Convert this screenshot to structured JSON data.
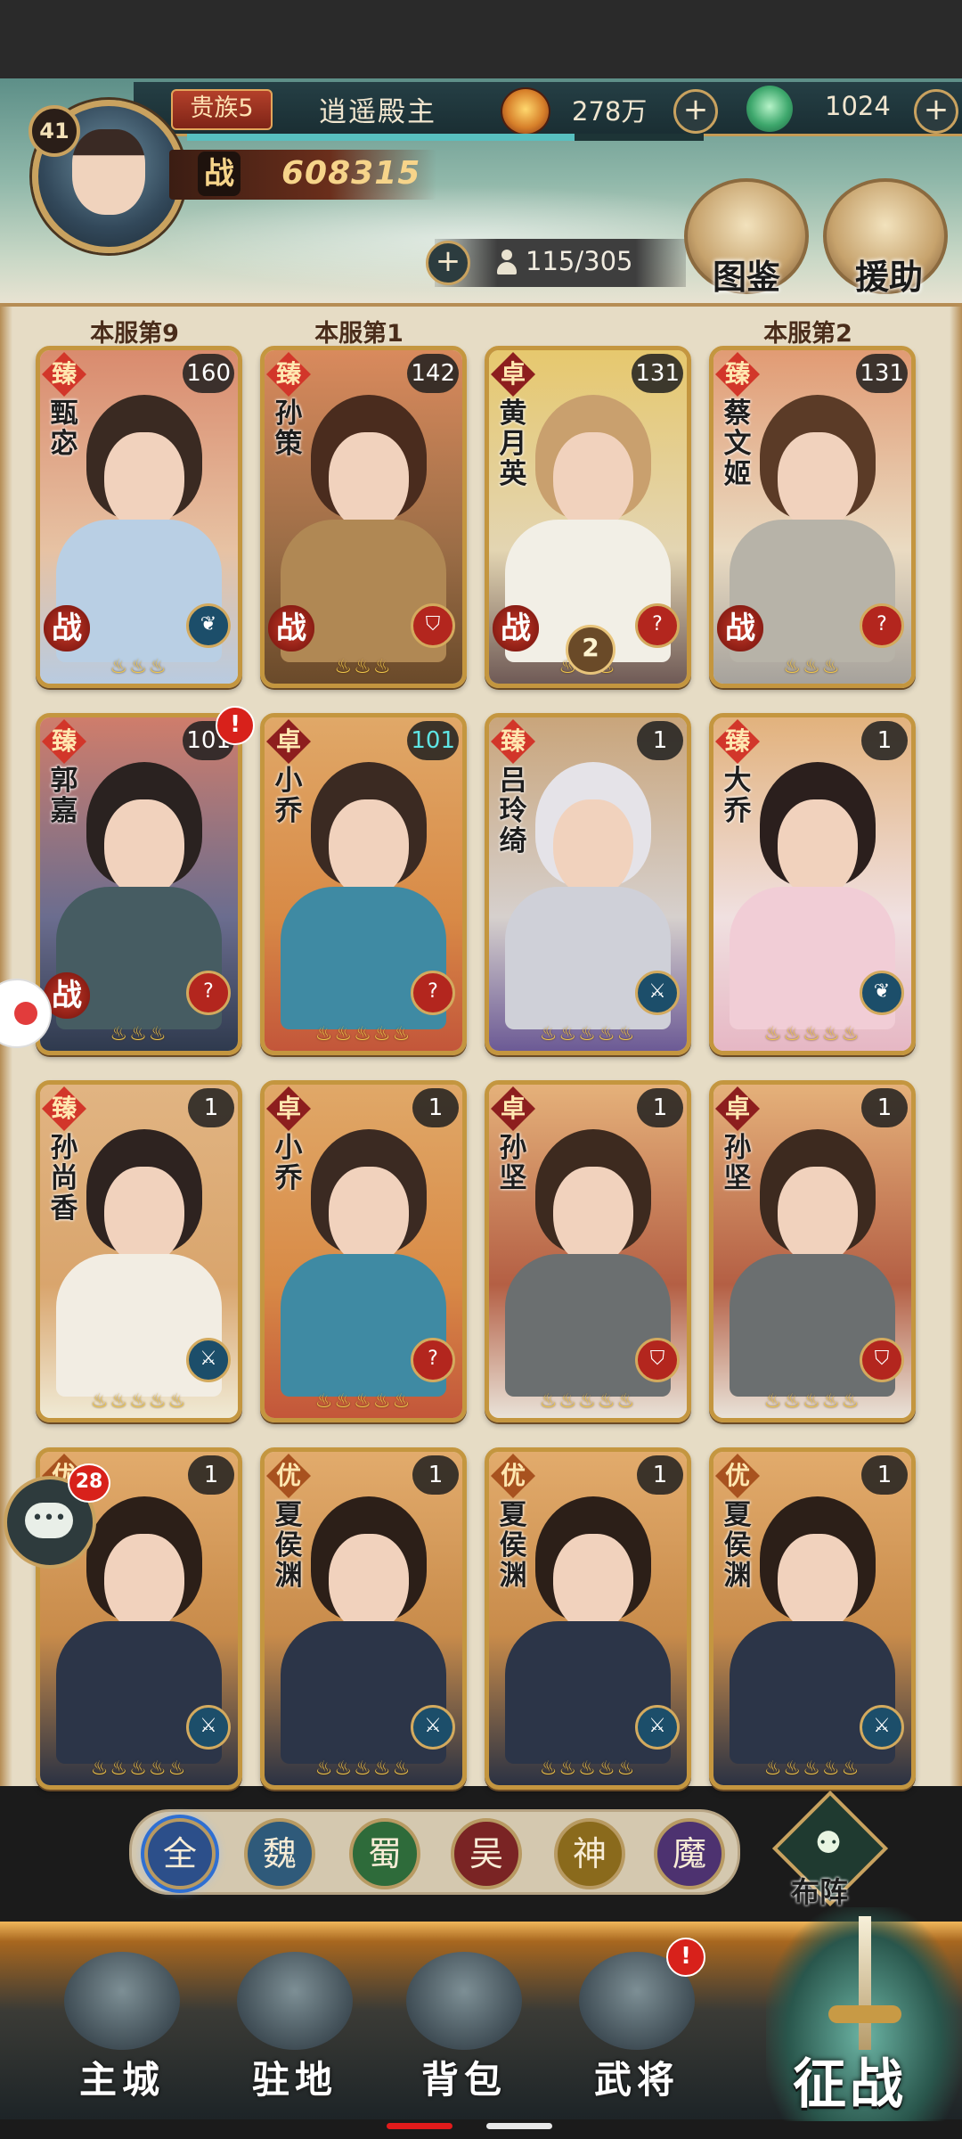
{
  "header": {
    "level": "41",
    "noble_rank": "贵族5",
    "title": "逍遥殿主",
    "coins": "278万",
    "jade": "1024",
    "power_icon": "战",
    "power": "608315",
    "capacity": "115/305",
    "codex_label": "图鉴",
    "support_label": "援助",
    "xp_fraction": 0.75
  },
  "cards": [
    {
      "name": "甄宓",
      "grade": "臻",
      "level": "160",
      "rank": "本服第9",
      "zhan": "战",
      "class": "support",
      "flames": "♨♨♨"
    },
    {
      "name": "孙策",
      "grade": "臻",
      "level": "142",
      "rank": "本服第1",
      "zhan": "战",
      "class": "shield",
      "flames": "♨♨♨"
    },
    {
      "name": "黄月英",
      "grade": "卓",
      "level": "131",
      "rank": "",
      "zhan": "战",
      "class": "strategist",
      "flames": "♨♨♨",
      "star": "2"
    },
    {
      "name": "蔡文姬",
      "grade": "臻",
      "level": "131",
      "rank": "本服第2",
      "zhan": "战",
      "class": "strategist",
      "flames": "♨♨♨"
    },
    {
      "name": "郭嘉",
      "grade": "臻",
      "level": "101",
      "rank": "",
      "zhan": "战",
      "class": "strategist",
      "flames": "♨♨♨",
      "alert": "!"
    },
    {
      "name": "小乔",
      "grade": "卓",
      "level": "101",
      "rank": "",
      "zhan": "",
      "class": "strategist",
      "flames": "♨♨♨♨♨"
    },
    {
      "name": "吕玲绮",
      "grade": "臻",
      "level": "1",
      "rank": "",
      "zhan": "",
      "class": "blade",
      "flames": "♨♨♨♨♨"
    },
    {
      "name": "大乔",
      "grade": "臻",
      "level": "1",
      "rank": "",
      "zhan": "",
      "class": "support",
      "flames": "♨♨♨♨♨"
    },
    {
      "name": "孙尚香",
      "grade": "臻",
      "level": "1",
      "rank": "",
      "zhan": "",
      "class": "blade",
      "flames": "♨♨♨♨♨"
    },
    {
      "name": "小乔",
      "grade": "卓",
      "level": "1",
      "rank": "",
      "zhan": "",
      "class": "strategist",
      "flames": "♨♨♨♨♨"
    },
    {
      "name": "孙坚",
      "grade": "卓",
      "level": "1",
      "rank": "",
      "zhan": "",
      "class": "shield",
      "flames": "♨♨♨♨♨"
    },
    {
      "name": "孙坚",
      "grade": "卓",
      "level": "1",
      "rank": "",
      "zhan": "",
      "class": "shield",
      "flames": "♨♨♨♨♨"
    },
    {
      "name": "渊",
      "grade": "优",
      "level": "1",
      "rank": "",
      "zhan": "",
      "class": "blade",
      "flames": "♨♨♨♨♨"
    },
    {
      "name": "夏侯渊",
      "grade": "优",
      "level": "1",
      "rank": "",
      "zhan": "",
      "class": "blade",
      "flames": "♨♨♨♨♨"
    },
    {
      "name": "夏侯渊",
      "grade": "优",
      "level": "1",
      "rank": "",
      "zhan": "",
      "class": "blade",
      "flames": "♨♨♨♨♨"
    },
    {
      "name": "夏侯渊",
      "grade": "优",
      "level": "1",
      "rank": "",
      "zhan": "",
      "class": "blade",
      "flames": "♨♨♨♨♨"
    }
  ],
  "class_icons": {
    "support": "❦",
    "shield": "⛉",
    "strategist": "?",
    "blade": "⚔"
  },
  "factions": [
    {
      "label": "全",
      "color": "#2c4f8a"
    },
    {
      "label": "魏",
      "color": "#2f5a7a"
    },
    {
      "label": "蜀",
      "color": "#2e6b3a"
    },
    {
      "label": "吴",
      "color": "#7a2424"
    },
    {
      "label": "神",
      "color": "#8a6a1c"
    },
    {
      "label": "魔",
      "color": "#4d3270"
    }
  ],
  "formation_label": "布阵",
  "chat_badge": "28",
  "nav": [
    {
      "label": "主城"
    },
    {
      "label": "驻地"
    },
    {
      "label": "背包"
    },
    {
      "label": "武将",
      "alert": "!"
    }
  ],
  "conquer_label": "征战"
}
